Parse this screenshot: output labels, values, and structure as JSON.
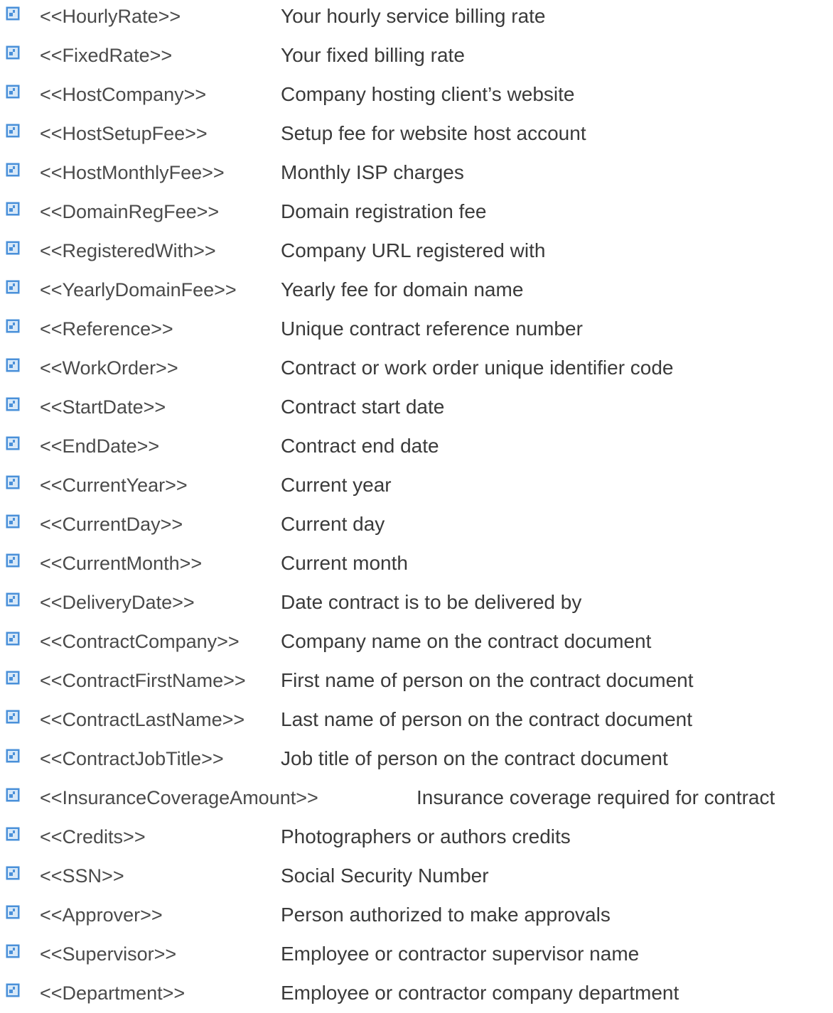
{
  "fields": [
    {
      "name": "<<HourlyRate>>",
      "description": "Your hourly service billing rate"
    },
    {
      "name": "<<FixedRate>>",
      "description": "Your fixed billing rate"
    },
    {
      "name": "<<HostCompany>>",
      "description": "Company hosting client’s website"
    },
    {
      "name": "<<HostSetupFee>>",
      "description": "Setup fee for website host account"
    },
    {
      "name": "<<HostMonthlyFee>>",
      "description": "Monthly ISP charges"
    },
    {
      "name": "<<DomainRegFee>>",
      "description": "Domain registration fee"
    },
    {
      "name": "<<RegisteredWith>>",
      "description": "Company URL registered with"
    },
    {
      "name": "<<YearlyDomainFee>>",
      "description": "Yearly fee for domain name"
    },
    {
      "name": "<<Reference>>",
      "description": "Unique contract reference number"
    },
    {
      "name": "<<WorkOrder>>",
      "description": "Contract or work order unique identifier code"
    },
    {
      "name": "<<StartDate>>",
      "description": "Contract start date"
    },
    {
      "name": "<<EndDate>>",
      "description": "Contract end date"
    },
    {
      "name": "<<CurrentYear>>",
      "description": "Current year"
    },
    {
      "name": "<<CurrentDay>>",
      "description": "Current day"
    },
    {
      "name": "<<CurrentMonth>>",
      "description": "Current month"
    },
    {
      "name": "<<DeliveryDate>>",
      "description": "Date contract is to be delivered by"
    },
    {
      "name": "<<ContractCompany>>",
      "description": "Company name on the contract document"
    },
    {
      "name": "<<ContractFirstName>>",
      "description": "First name of person on the contract document"
    },
    {
      "name": "<<ContractLastName>>",
      "description": "Last name of person on the contract document"
    },
    {
      "name": "<<ContractJobTitle>>",
      "description": "Job title of person on the contract document"
    },
    {
      "name": "<<InsuranceCoverageAmount>>",
      "description": "Insurance coverage required for contract"
    },
    {
      "name": "<<Credits>>",
      "description": "Photographers or authors credits"
    },
    {
      "name": "<<SSN>>",
      "description": "Social Security Number"
    },
    {
      "name": "<<Approver>>",
      "description": "Person authorized to make approvals"
    },
    {
      "name": "<<Supervisor>>",
      "description": "Employee or contractor supervisor name"
    },
    {
      "name": "<<Department>>",
      "description": "Employee or contractor company department"
    }
  ],
  "icons": {
    "bullet": "document-bullet-icon",
    "bullet_color": "#4a90d9",
    "bullet_light": "#d7e8f8"
  }
}
